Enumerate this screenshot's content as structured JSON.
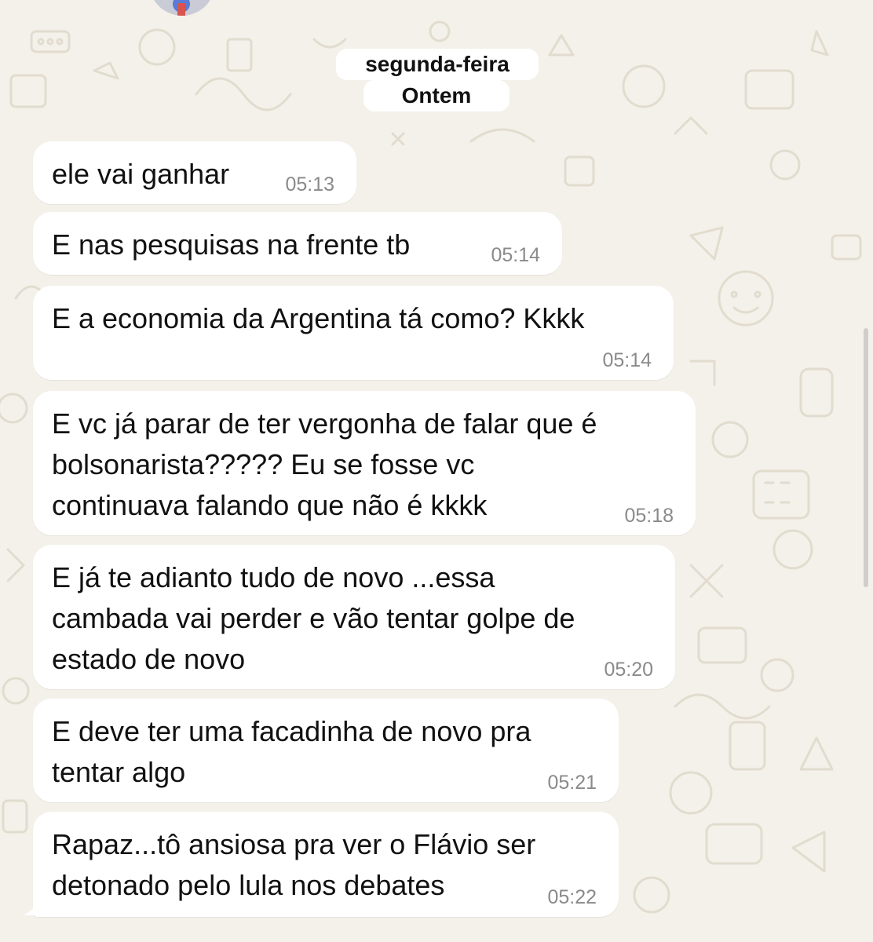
{
  "date_chip": {
    "weekday": "segunda-feira",
    "relative": "Ontem"
  },
  "messages": [
    {
      "text": "ele vai ganhar",
      "time": "05:13"
    },
    {
      "text": "E nas pesquisas na frente tb",
      "time": "05:14"
    },
    {
      "text": "E a economia da Argentina tá como? Kkkk",
      "time": "05:14"
    },
    {
      "text": "E vc já parar de ter vergonha de falar que é\nbolsonarista????? Eu se fosse vc\ncontinuava falando que não é kkkk",
      "time": "05:18"
    },
    {
      "text": "E já te adianto tudo de novo ...essa\ncambada vai perder e vão tentar golpe de\nestado de novo",
      "time": "05:20"
    },
    {
      "text": "E deve ter uma facadinha de novo pra\ntentar algo",
      "time": "05:21"
    },
    {
      "text": "Rapaz...tô ansiosa pra ver o Flávio ser\ndetonado pelo lula nos debates",
      "time": "05:22"
    }
  ],
  "colors": {
    "background": "#f4f1ea",
    "bubble": "#ffffff",
    "timestamp": "#8a8a8a"
  }
}
